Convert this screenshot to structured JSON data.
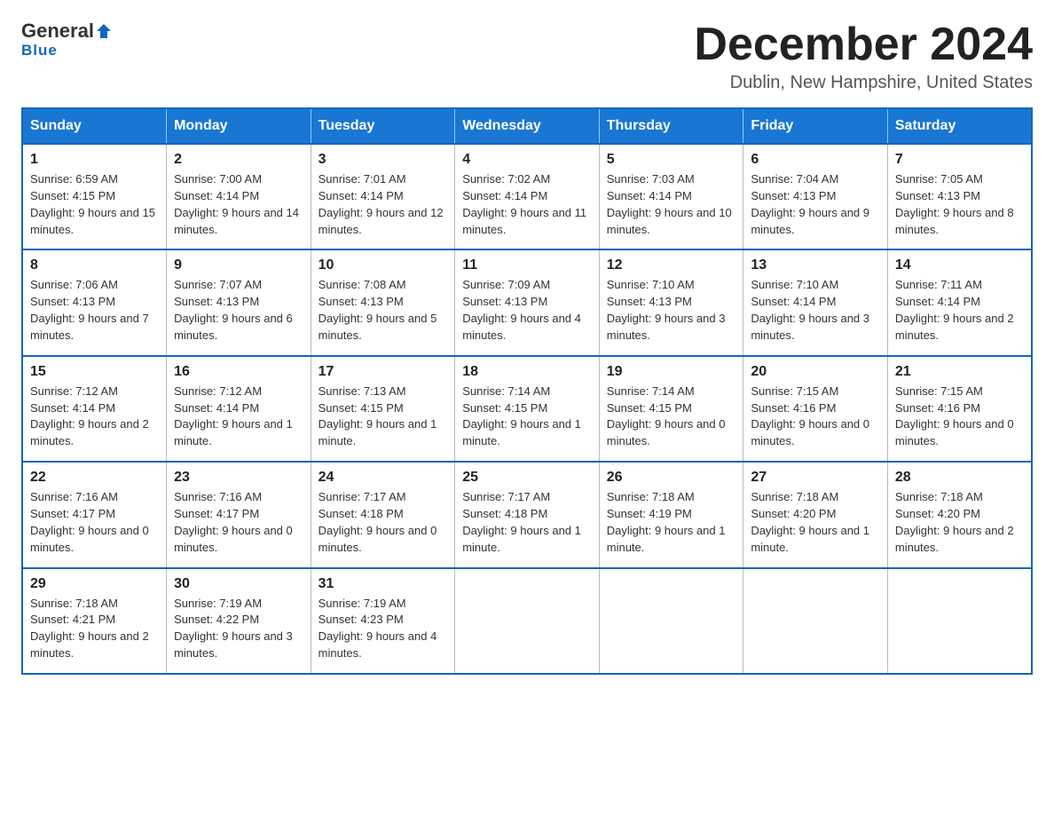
{
  "logo": {
    "text_general": "General",
    "arrow": "▼",
    "text_blue": "Blue"
  },
  "title": "December 2024",
  "location": "Dublin, New Hampshire, United States",
  "days_of_week": [
    "Sunday",
    "Monday",
    "Tuesday",
    "Wednesday",
    "Thursday",
    "Friday",
    "Saturday"
  ],
  "weeks": [
    [
      {
        "day": "1",
        "sunrise": "Sunrise: 6:59 AM",
        "sunset": "Sunset: 4:15 PM",
        "daylight": "Daylight: 9 hours and 15 minutes."
      },
      {
        "day": "2",
        "sunrise": "Sunrise: 7:00 AM",
        "sunset": "Sunset: 4:14 PM",
        "daylight": "Daylight: 9 hours and 14 minutes."
      },
      {
        "day": "3",
        "sunrise": "Sunrise: 7:01 AM",
        "sunset": "Sunset: 4:14 PM",
        "daylight": "Daylight: 9 hours and 12 minutes."
      },
      {
        "day": "4",
        "sunrise": "Sunrise: 7:02 AM",
        "sunset": "Sunset: 4:14 PM",
        "daylight": "Daylight: 9 hours and 11 minutes."
      },
      {
        "day": "5",
        "sunrise": "Sunrise: 7:03 AM",
        "sunset": "Sunset: 4:14 PM",
        "daylight": "Daylight: 9 hours and 10 minutes."
      },
      {
        "day": "6",
        "sunrise": "Sunrise: 7:04 AM",
        "sunset": "Sunset: 4:13 PM",
        "daylight": "Daylight: 9 hours and 9 minutes."
      },
      {
        "day": "7",
        "sunrise": "Sunrise: 7:05 AM",
        "sunset": "Sunset: 4:13 PM",
        "daylight": "Daylight: 9 hours and 8 minutes."
      }
    ],
    [
      {
        "day": "8",
        "sunrise": "Sunrise: 7:06 AM",
        "sunset": "Sunset: 4:13 PM",
        "daylight": "Daylight: 9 hours and 7 minutes."
      },
      {
        "day": "9",
        "sunrise": "Sunrise: 7:07 AM",
        "sunset": "Sunset: 4:13 PM",
        "daylight": "Daylight: 9 hours and 6 minutes."
      },
      {
        "day": "10",
        "sunrise": "Sunrise: 7:08 AM",
        "sunset": "Sunset: 4:13 PM",
        "daylight": "Daylight: 9 hours and 5 minutes."
      },
      {
        "day": "11",
        "sunrise": "Sunrise: 7:09 AM",
        "sunset": "Sunset: 4:13 PM",
        "daylight": "Daylight: 9 hours and 4 minutes."
      },
      {
        "day": "12",
        "sunrise": "Sunrise: 7:10 AM",
        "sunset": "Sunset: 4:13 PM",
        "daylight": "Daylight: 9 hours and 3 minutes."
      },
      {
        "day": "13",
        "sunrise": "Sunrise: 7:10 AM",
        "sunset": "Sunset: 4:14 PM",
        "daylight": "Daylight: 9 hours and 3 minutes."
      },
      {
        "day": "14",
        "sunrise": "Sunrise: 7:11 AM",
        "sunset": "Sunset: 4:14 PM",
        "daylight": "Daylight: 9 hours and 2 minutes."
      }
    ],
    [
      {
        "day": "15",
        "sunrise": "Sunrise: 7:12 AM",
        "sunset": "Sunset: 4:14 PM",
        "daylight": "Daylight: 9 hours and 2 minutes."
      },
      {
        "day": "16",
        "sunrise": "Sunrise: 7:12 AM",
        "sunset": "Sunset: 4:14 PM",
        "daylight": "Daylight: 9 hours and 1 minute."
      },
      {
        "day": "17",
        "sunrise": "Sunrise: 7:13 AM",
        "sunset": "Sunset: 4:15 PM",
        "daylight": "Daylight: 9 hours and 1 minute."
      },
      {
        "day": "18",
        "sunrise": "Sunrise: 7:14 AM",
        "sunset": "Sunset: 4:15 PM",
        "daylight": "Daylight: 9 hours and 1 minute."
      },
      {
        "day": "19",
        "sunrise": "Sunrise: 7:14 AM",
        "sunset": "Sunset: 4:15 PM",
        "daylight": "Daylight: 9 hours and 0 minutes."
      },
      {
        "day": "20",
        "sunrise": "Sunrise: 7:15 AM",
        "sunset": "Sunset: 4:16 PM",
        "daylight": "Daylight: 9 hours and 0 minutes."
      },
      {
        "day": "21",
        "sunrise": "Sunrise: 7:15 AM",
        "sunset": "Sunset: 4:16 PM",
        "daylight": "Daylight: 9 hours and 0 minutes."
      }
    ],
    [
      {
        "day": "22",
        "sunrise": "Sunrise: 7:16 AM",
        "sunset": "Sunset: 4:17 PM",
        "daylight": "Daylight: 9 hours and 0 minutes."
      },
      {
        "day": "23",
        "sunrise": "Sunrise: 7:16 AM",
        "sunset": "Sunset: 4:17 PM",
        "daylight": "Daylight: 9 hours and 0 minutes."
      },
      {
        "day": "24",
        "sunrise": "Sunrise: 7:17 AM",
        "sunset": "Sunset: 4:18 PM",
        "daylight": "Daylight: 9 hours and 0 minutes."
      },
      {
        "day": "25",
        "sunrise": "Sunrise: 7:17 AM",
        "sunset": "Sunset: 4:18 PM",
        "daylight": "Daylight: 9 hours and 1 minute."
      },
      {
        "day": "26",
        "sunrise": "Sunrise: 7:18 AM",
        "sunset": "Sunset: 4:19 PM",
        "daylight": "Daylight: 9 hours and 1 minute."
      },
      {
        "day": "27",
        "sunrise": "Sunrise: 7:18 AM",
        "sunset": "Sunset: 4:20 PM",
        "daylight": "Daylight: 9 hours and 1 minute."
      },
      {
        "day": "28",
        "sunrise": "Sunrise: 7:18 AM",
        "sunset": "Sunset: 4:20 PM",
        "daylight": "Daylight: 9 hours and 2 minutes."
      }
    ],
    [
      {
        "day": "29",
        "sunrise": "Sunrise: 7:18 AM",
        "sunset": "Sunset: 4:21 PM",
        "daylight": "Daylight: 9 hours and 2 minutes."
      },
      {
        "day": "30",
        "sunrise": "Sunrise: 7:19 AM",
        "sunset": "Sunset: 4:22 PM",
        "daylight": "Daylight: 9 hours and 3 minutes."
      },
      {
        "day": "31",
        "sunrise": "Sunrise: 7:19 AM",
        "sunset": "Sunset: 4:23 PM",
        "daylight": "Daylight: 9 hours and 4 minutes."
      },
      null,
      null,
      null,
      null
    ]
  ]
}
